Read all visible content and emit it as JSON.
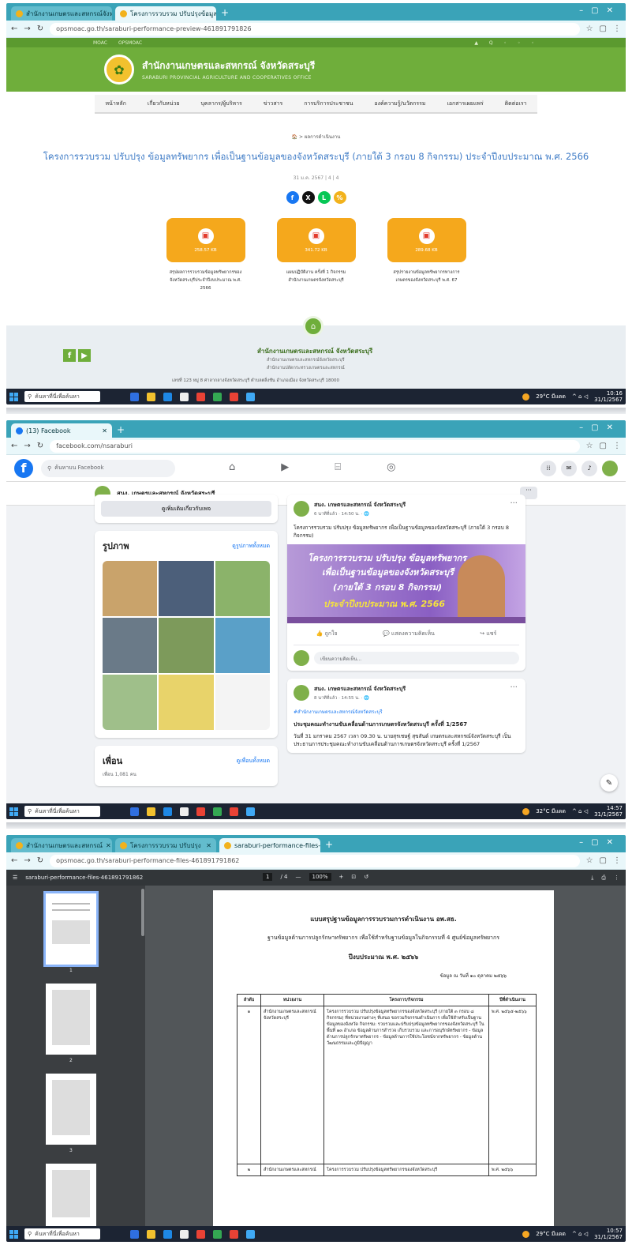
{
  "shot1": {
    "tabs": [
      "สำนักงานเกษตรและสหกรณ์จังหวัดสระบุรี",
      "โครงการรวบรวม ปรับปรุงข้อมูลทรัพยากร"
    ],
    "url": "opsmoac.go.th/saraburi-performance-preview-461891791826",
    "topbar": {
      "left1": "MOAC",
      "left2": "OPSMOAC",
      "right": "▲  Q  ◦  ◦  ◦"
    },
    "org_th": "สำนักงานเกษตรและสหกรณ์ จังหวัดสระบุรี",
    "org_en": "SARABURI PROVINCIAL AGRICULTURE AND COOPERATIVES OFFICE",
    "nav": [
      "หน้าหลัก",
      "เกี่ยวกับหน่วย",
      "บุคลากร/ผู้บริหาร",
      "ข่าวสาร",
      "การบริการประชาชน",
      "องค์ความรู้/นวัตกรรม",
      "เอกสารเผยแพร่",
      "ติดต่อเรา"
    ],
    "breadcrumb": "🏠  >  ผลการดำเนินงาน",
    "title": "โครงการรวบรวม ปรับปรุง ข้อมูลทรัพยากร เพื่อเป็นฐานข้อมูลของจังหวัดสระบุรี (ภายใต้ 3 กรอบ 8 กิจกรรม) ประจำปีงบประมาณ พ.ศ. 2566",
    "meta": "31 ม.ค. 2567   |   4   |   4",
    "files": [
      {
        "size": "258.57 KB",
        "name": "สรุปผลการรวบรวมข้อมูลทรัพยากรของจังหวัดสระบุรีประจำปีงบประมาณ พ.ศ. 2566"
      },
      {
        "size": "341.72 KB",
        "name": "แผนปฏิบัติงาน ครั้งที่ 1 กิจกรรม สำนักงานเกษตรจังหวัดสระบุรี"
      },
      {
        "size": "289.68 KB",
        "name": "สรุปรายงานข้อมูลทรัพยากรทางการเกษตรของจังหวัดสระบุรี พ.ศ. 67"
      }
    ],
    "footer": {
      "org": "สำนักงานเกษตรและสหกรณ์ จังหวัดสระบุรี",
      "line1": "สำนักงานเกษตรและสหกรณ์จังหวัดสระบุรี",
      "line2": "สำนักงานปลัดกระทรวงเกษตรและสหกรณ์",
      "address": "เลขที่ 123 หมู่ 8 ศาลากลางจังหวัดสระบุรี ตำบลตลิ่งชัน อำเภอเมือง จังหวัดสระบุรี 18000"
    },
    "taskbar": {
      "search": "ค้นหาที่นี่เพื่อค้นหา",
      "weather": "29°C มีแดด",
      "time": "10:16",
      "date": "31/1/2567"
    }
  },
  "shot2": {
    "tabs": [
      "(13) Facebook"
    ],
    "url": "facebook.com/nsaraburi",
    "search_placeholder": "ค้นหาบน Facebook",
    "page_name": "สนง. เกษตรและสหกรณ์ จังหวัดสระบุรี",
    "more_button": "ดูเพิ่มเติมเกี่ยวกับเพจ",
    "photos_title": "รูปภาพ",
    "photos_link": "ดูรูปภาพทั้งหมด",
    "friends_title": "เพื่อน",
    "friends_link": "ดูเพื่อนทั้งหมด",
    "friends_count": "เพื่อน 1,081 คน",
    "post1": {
      "name": "สนง. เกษตรและสหกรณ์ จังหวัดสระบุรี",
      "time": "6 นาทีที่แล้ว · 14:50 น. · 🌐",
      "text": "โครงการรวบรวม ปรับปรุง ข้อมูลทรัพยากร เพื่อเป็นฐานข้อมูลของจังหวัดสระบุรี (ภายใต้ 3 กรอบ 8 กิจกรรม)",
      "banner": [
        "โครงการรวบรวม ปรับปรุง ข้อมูลทรัพยากร",
        "เพื่อเป็นฐานข้อมูลของจังหวัดสระบุรี",
        "(ภายใต้ 3 กรอบ 8 กิจกรรม)",
        "ประจำปีงบประมาณ พ.ศ. 2566"
      ],
      "like": "ถูกใจ",
      "comment": "แสดงความคิดเห็น",
      "share": "แชร์",
      "comment_placeholder": "เขียนความคิดเห็น..."
    },
    "post2": {
      "name": "สนง. เกษตรและสหกรณ์ จังหวัดสระบุรี",
      "time": "8 นาทีที่แล้ว · 14:55 น. · 🌐",
      "summary": "#สำนักงานเกษตรและสหกรณ์จังหวัดสระบุรี",
      "title": "ประชุมคณะทำงานขับเคลื่อนด้านการเกษตรจังหวัดสระบุรี ครั้งที่ 1/2567",
      "text": "วันที่ 31 มกราคม 2567 เวลา 09.30 น. นายสุรเชษฐ์ สุขสันต์ เกษตรและสหกรณ์จังหวัดสระบุรี เป็นประธานการประชุมคณะทำงานขับเคลื่อนด้านการเกษตรจังหวัดสระบุรี ครั้งที่ 1/2567"
    },
    "taskbar": {
      "search": "ค้นหาที่นี่เพื่อค้นหา",
      "weather": "32°C มีแดด",
      "time": "14:57",
      "date": "31/1/2567"
    }
  },
  "shot3": {
    "tabs": [
      "สำนักงานเกษตรและสหกรณ์",
      "โครงการรวบรวม ปรับปรุง",
      "saraburi-performance-files-461"
    ],
    "url": "opsmoac.go.th/saraburi-performance-files-461891791862",
    "file_name": "saraburi-performance-files-461891791862",
    "page": "1",
    "pages": "/ 4",
    "zoom": "100%",
    "thumb_labels": [
      "1",
      "2",
      "3"
    ],
    "doc": {
      "h1": "แบบสรุปฐานข้อมูลการรวบรวมการดำเนินงาน อพ.สธ.",
      "h2": "ฐานข้อมูลด้านการปลูกรักษาทรัพยากร เพื่อใช้สำหรับฐานข้อมูลในกิจกรรมที่ 4 ศูนย์ข้อมูลทรัพยากร",
      "h3": "ปีงบประมาณ พ.ศ. ๒๕๖๖",
      "date": "ข้อมูล ณ วันที่ ๑๐ ตุลาคม ๒๕๖๖",
      "headers": [
        "ลำดับ",
        "หน่วยงาน",
        "โครงการ/กิจกรรม",
        "ปีที่ดำเนินงาน"
      ],
      "rows": [
        [
          "๑",
          "สำนักงานเกษตรและสหกรณ์จังหวัดสระบุรี",
          "โครงการรวบรวม ปรับปรุงข้อมูลทรัพยากรของจังหวัดสระบุรี (ภายใต้ ๓ กรอบ ๘ กิจกรรม) ที่หน่วยงานต่างๆ ที่เสนอ ขอรวมกิจกรรมดำเนินการ เพื่อใช้สำหรับเป็นฐานข้อมูลของจังหวัด กิจกรรม: รวบรวมและปรับปรุงข้อมูลทรัพยากรของจังหวัดสระบุรี ในพื้นที่ ๑๓ อำเภอ ข้อมูลด้านการสำรวจ เก็บรวบรวม และการอนุรักษ์ทรัพยากร - ข้อมูลด้านการปลูกรักษาทรัพยากร - ข้อมูลด้านการใช้ประโยชน์จากทรัพยากร - ข้อมูลด้านวัฒนธรรมและภูมิปัญญา",
          "พ.ศ. ๒๕๖๕-๒๕๖๖"
        ],
        [
          "๒",
          "สำนักงานเกษตรและสหกรณ์",
          "โครงการรวบรวม ปรับปรุงข้อมูลทรัพยากรของจังหวัดสระบุรี",
          "พ.ศ. ๒๕๖๖"
        ]
      ]
    },
    "taskbar": {
      "search": "ค้นหาที่นี่เพื่อค้นหา",
      "weather": "29°C มีแดด",
      "time": "10:57",
      "date": "31/1/2567"
    }
  }
}
